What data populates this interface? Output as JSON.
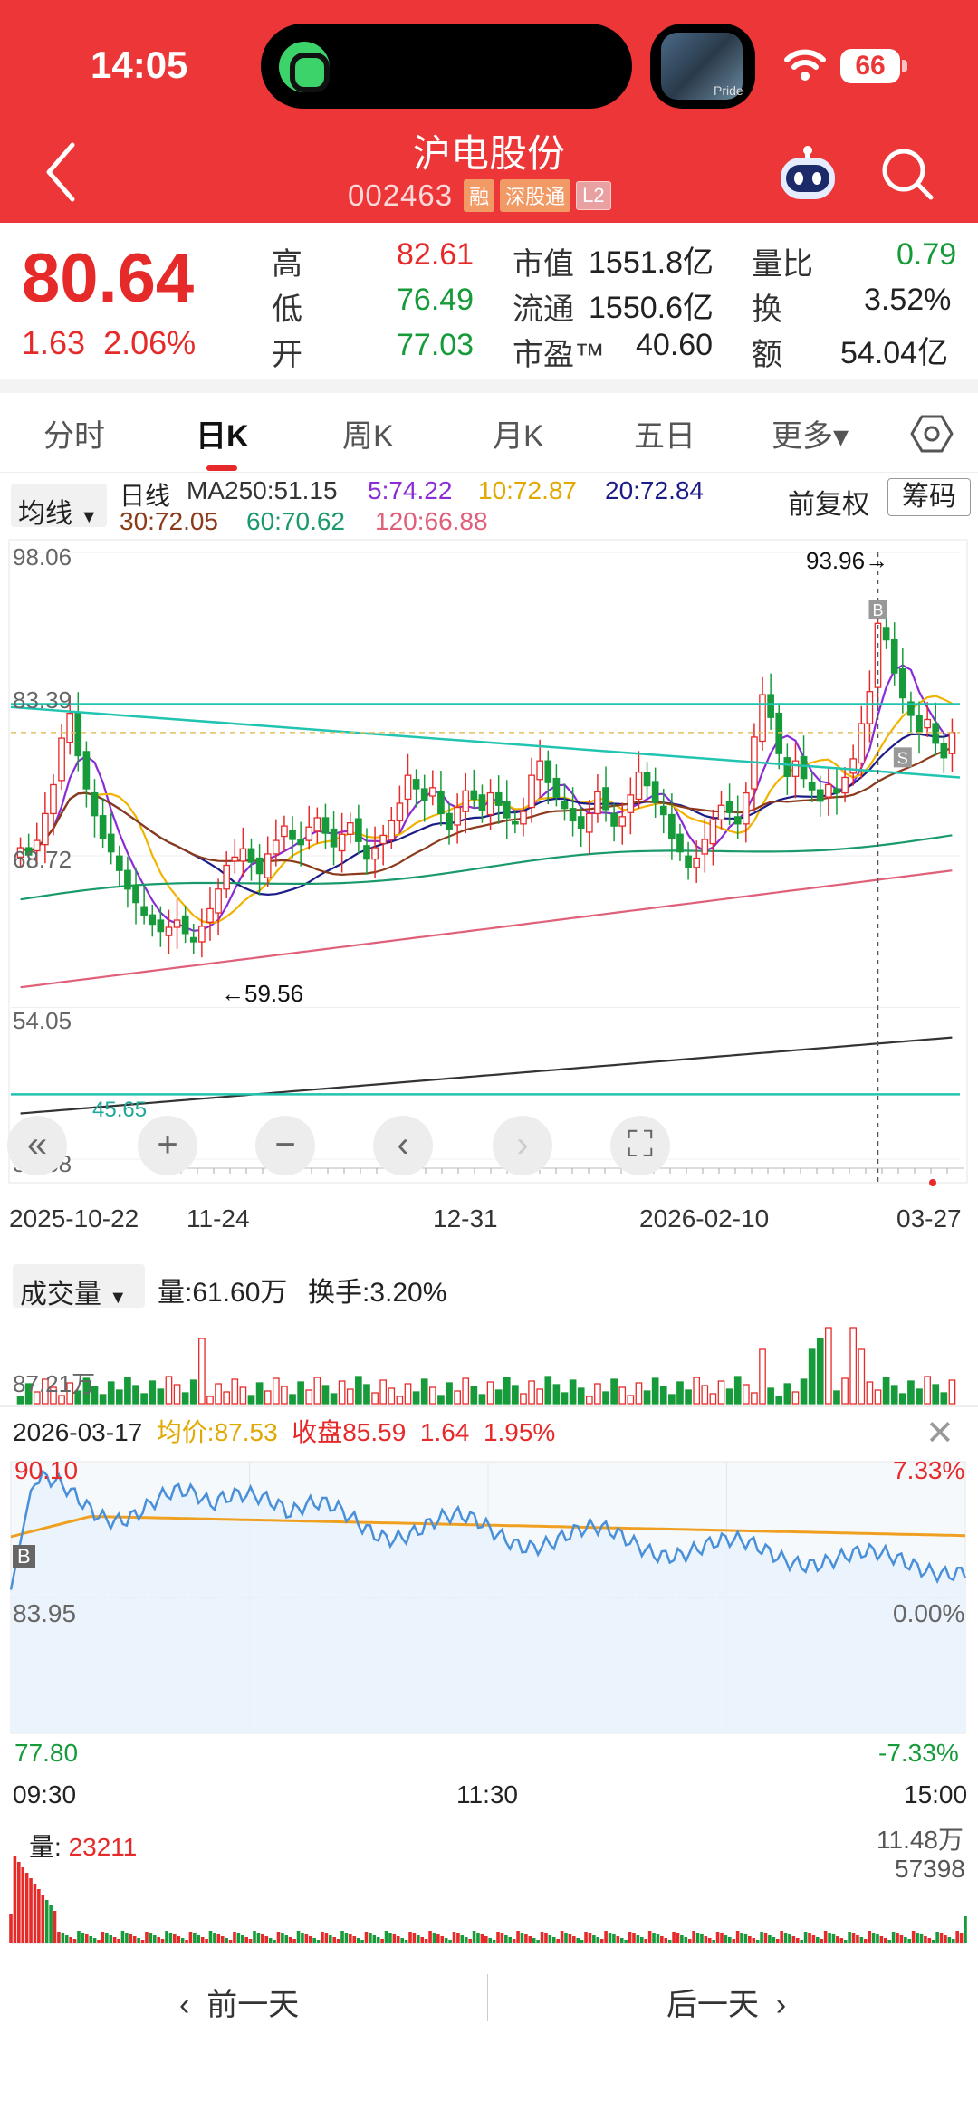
{
  "status": {
    "time": "14:05",
    "battery": "66",
    "music_label": "Pride"
  },
  "header": {
    "title": "沪电股份",
    "code": "002463",
    "tags": [
      "融",
      "深股通",
      "L2"
    ]
  },
  "quote": {
    "price": "80.64",
    "change": "1.63",
    "change_pct": "2.06%",
    "high_label": "高",
    "high": "82.61",
    "low_label": "低",
    "low": "76.49",
    "open_label": "开",
    "open": "77.03",
    "mcap_label": "市值",
    "mcap": "1551.8亿",
    "float_label": "流通",
    "float": "1550.6亿",
    "pe_label": "市盈™",
    "pe": "40.60",
    "vr_label": "量比",
    "vr": "0.79",
    "turnover_label": "换",
    "turnover": "3.52%",
    "amount_label": "额",
    "amount": "54.04亿"
  },
  "tabs": [
    "分时",
    "日K",
    "周K",
    "月K",
    "五日",
    "更多▾"
  ],
  "active_tab": "日K",
  "ma": {
    "select": "均线",
    "line_type": "日线",
    "ma250": "MA250:51.15",
    "ma5": "5:74.22",
    "ma10": "10:72.87",
    "ma20": "20:72.84",
    "ma30": "30:72.05",
    "ma60": "60:70.62",
    "ma120": "120:66.88",
    "adjust": "前复权",
    "chips": "筹码"
  },
  "colors": {
    "up": "#e62a2a",
    "down": "#179b3a",
    "ma5": "#8b2bd6",
    "ma10": "#f0b400",
    "ma20": "#1c1c88",
    "ma30": "#8b3a1a",
    "ma60": "#1a9a6a",
    "ma120": "#e0607a",
    "ma250": "#333333",
    "trend": "#21c4b0",
    "intraday_price": "#4a90d9",
    "intraday_avg": "#f0a020"
  },
  "chart_data": [
    {
      "type": "candlestick",
      "title": "日K",
      "y_ticks": [
        "98.06",
        "83.39",
        "68.72",
        "54.05",
        "39.38"
      ],
      "ylim": [
        39.38,
        98.06
      ],
      "x_ticks": [
        "2025-10-22",
        "11-24",
        "12-31",
        "2026-02-10",
        "03-27"
      ],
      "annotations": {
        "high_mark": "93.96→",
        "low_mark": "←59.56",
        "level_label": "45.65",
        "buy_marker": "B",
        "sell_marker": "S"
      },
      "horizontal_levels": [
        83.39,
        45.65
      ],
      "current_price": 80.64,
      "closes": [
        69.5,
        68.8,
        70.2,
        72.8,
        75.6,
        80.1,
        82.5,
        78.4,
        75.2,
        72.6,
        70.4,
        69.1,
        67.3,
        65.5,
        64.2,
        63.0,
        62.1,
        61.4,
        61.8,
        62.5,
        61.2,
        60.4,
        61.9,
        63.6,
        65.5,
        67.8,
        68.6,
        69.4,
        68.1,
        67.0,
        68.9,
        70.2,
        71.6,
        70.3,
        69.8,
        71.5,
        72.4,
        70.9,
        69.6,
        70.8,
        71.9,
        70.1,
        68.4,
        69.5,
        70.7,
        72.1,
        73.8,
        76.5,
        75.2,
        74.1,
        75.3,
        72.8,
        71.3,
        73.4,
        75.0,
        74.2,
        73.1,
        74.8,
        73.6,
        72.4,
        71.8,
        73.0,
        76.5,
        77.9,
        75.8,
        74.4,
        73.3,
        72.1,
        71.4,
        72.8,
        74.9,
        73.2,
        71.6,
        72.5,
        74.6,
        76.8,
        75.5,
        73.9,
        72.7,
        70.4,
        69.1,
        67.6,
        68.5,
        70.3,
        72.2,
        73.6,
        72.9,
        71.8,
        74.8,
        80.2,
        84.3,
        82.1,
        78.6,
        76.4,
        77.9,
        76.2,
        75.1,
        74.0,
        75.6,
        74.8,
        76.3,
        78.1,
        81.5,
        84.6,
        91.2,
        89.6,
        86.4,
        84.0,
        82.3,
        80.7,
        81.9,
        79.6,
        78.2,
        80.64
      ],
      "ma250_start": 45.65,
      "ma250_end": 51.15
    },
    {
      "type": "bar",
      "title": "成交量",
      "select": "成交量",
      "volume_text": "量:61.60万",
      "turnover_text": "换手:3.20%",
      "y_tick": "87.21万"
    },
    {
      "type": "line",
      "title": "2026-03-17",
      "avg_label": "均价:",
      "avg_value": "87.53",
      "close_label": "收盘",
      "close_value": "85.59",
      "change": "1.64",
      "change_pct": "1.95%",
      "y_ticks": [
        "90.10",
        "83.95",
        "77.80"
      ],
      "pct_ticks": [
        "7.33%",
        "0.00%",
        "-7.33%"
      ],
      "x_ticks": [
        "09:30",
        "11:30",
        "15:00"
      ],
      "ylim": [
        77.8,
        90.1
      ],
      "prev_close": 83.95,
      "buy_marker": "B",
      "volume_label": "量:",
      "volume_value": "23211",
      "vol_ticks": [
        "11.48万",
        "57398"
      ]
    }
  ],
  "nav": {
    "prev": "前一天",
    "next": "后一天"
  }
}
